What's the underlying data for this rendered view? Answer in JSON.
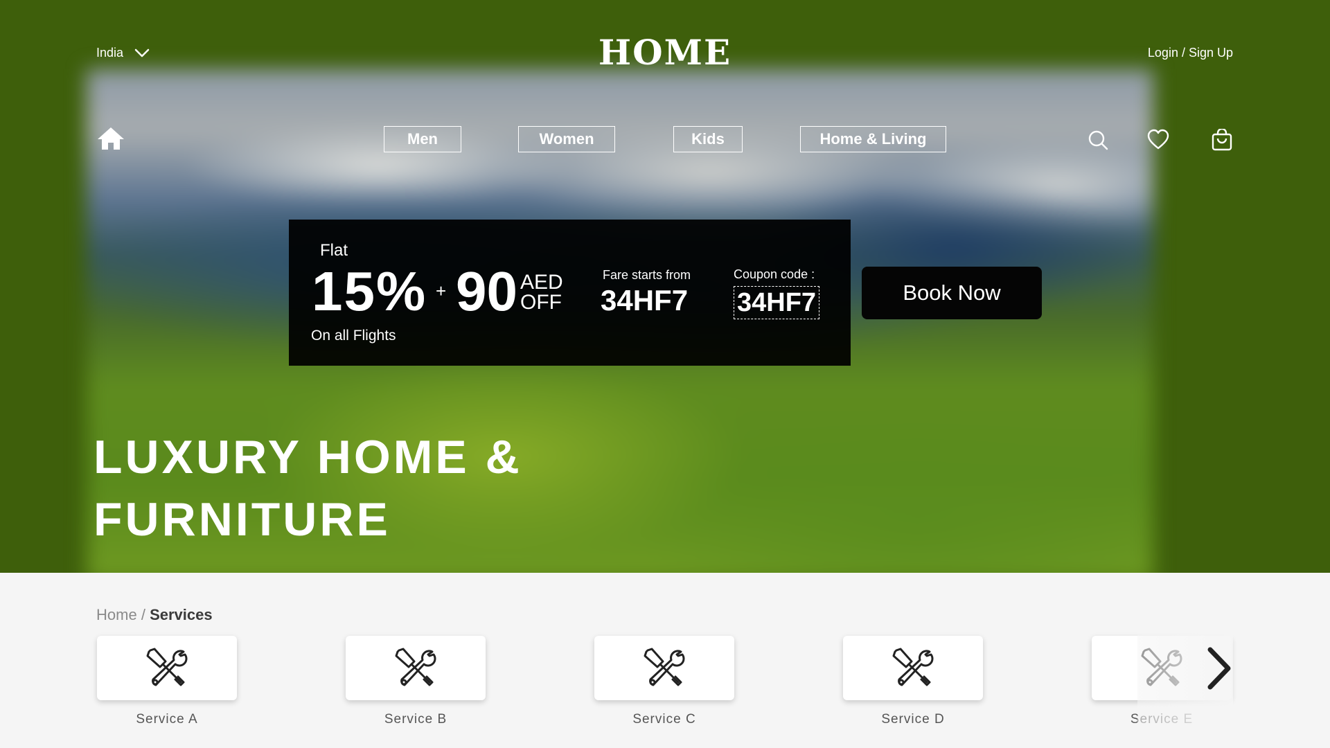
{
  "header": {
    "country": "India",
    "logo": "HOME",
    "login": "Login / Sign Up"
  },
  "nav": {
    "items": [
      "Men",
      "Women",
      "Kids",
      "Home & Living"
    ]
  },
  "icons": {
    "home": "home-icon",
    "country_toggle": "chevron-down-icon",
    "search": "search-icon",
    "wishlist": "heart-icon",
    "cart": "shopping-bag-icon",
    "service": "tools-icon",
    "carousel_next": "chevron-right-icon"
  },
  "promo": {
    "flat": "Flat",
    "percent": "15%",
    "plus": "+",
    "amount": "90",
    "currency": "AED",
    "off": "OFF",
    "subtitle": "On all Flights",
    "fare_label": "Fare starts from",
    "fare_value": "34HF7",
    "coupon_label": "Coupon code :",
    "coupon_value": "34HF7",
    "book_button": "Book Now"
  },
  "headline": {
    "line1": "LUXURY HOME &",
    "line2": "FURNITURE"
  },
  "breadcrumb": {
    "home": "Home",
    "separator": "/",
    "current": "Services"
  },
  "services": [
    "Service A",
    "Service B",
    "Service C",
    "Service D",
    "Service E"
  ],
  "colors": {
    "hero_green": "#3e5f0b",
    "promo_bg": "#000000",
    "page_bg": "#f5f5f5"
  }
}
